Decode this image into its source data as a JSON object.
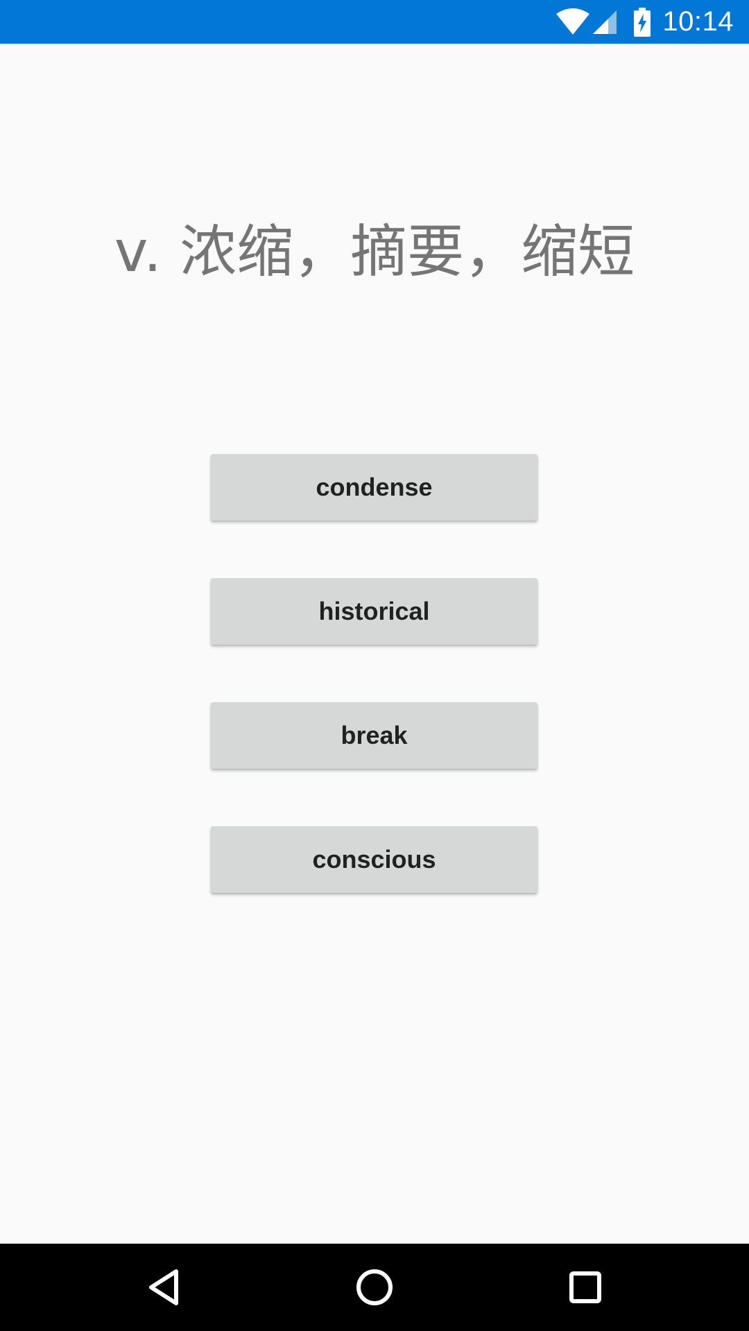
{
  "status_bar": {
    "time": "10:14",
    "color": "#0277d6",
    "icons": [
      "wifi-icon",
      "cell-signal-icon",
      "battery-charging-icon"
    ]
  },
  "quiz": {
    "prompt": "v. 浓缩，摘要，缩短",
    "options": [
      {
        "label": "condense"
      },
      {
        "label": "historical"
      },
      {
        "label": "break"
      },
      {
        "label": "conscious"
      }
    ]
  },
  "nav_bar": {
    "icons": [
      "back-icon",
      "home-icon",
      "recents-icon"
    ]
  }
}
